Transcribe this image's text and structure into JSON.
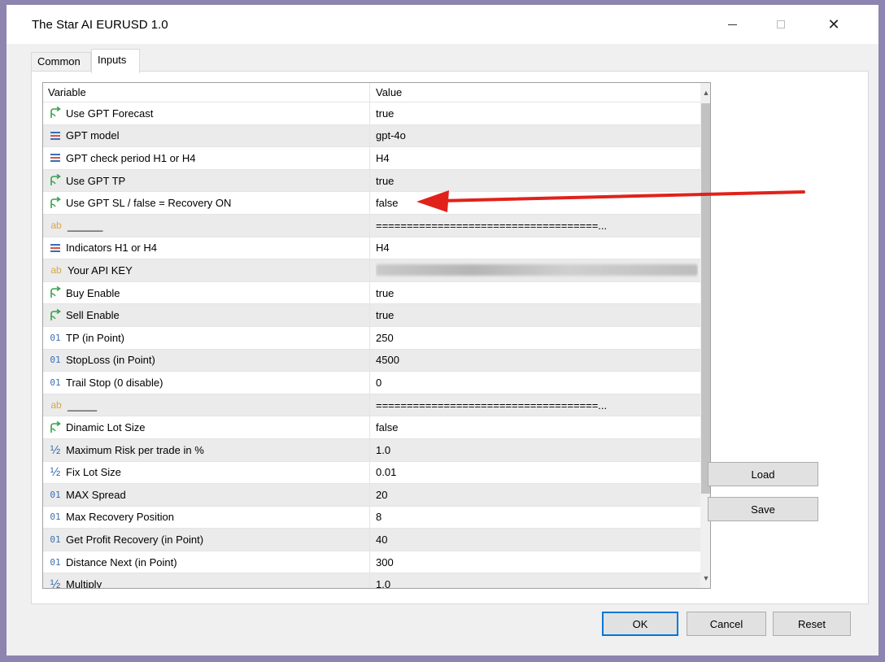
{
  "window": {
    "title": "The Star AI EURUSD 1.0"
  },
  "tabs": [
    {
      "label": "Common"
    },
    {
      "label": "Inputs"
    }
  ],
  "grid": {
    "columns": [
      "Variable",
      "Value"
    ],
    "rows": [
      {
        "icon": "toggle-arrow-icon",
        "variable": "Use GPT Forecast",
        "value": "true"
      },
      {
        "icon": "enum-list-icon",
        "variable": "GPT model",
        "value": "gpt-4o"
      },
      {
        "icon": "enum-list-icon",
        "variable": "GPT check period H1 or H4",
        "value": "H4"
      },
      {
        "icon": "toggle-arrow-icon",
        "variable": "Use GPT TP",
        "value": "true"
      },
      {
        "icon": "toggle-arrow-icon",
        "variable": "Use GPT SL / false = Recovery ON",
        "value": "false"
      },
      {
        "icon": "string-ab-icon",
        "variable": "______",
        "value": "====================================..."
      },
      {
        "icon": "enum-list-icon",
        "variable": "Indicators H1 or H4",
        "value": "H4"
      },
      {
        "icon": "string-ab-icon",
        "variable": "Your API KEY",
        "value": ""
      },
      {
        "icon": "toggle-arrow-icon",
        "variable": "Buy Enable",
        "value": "true"
      },
      {
        "icon": "toggle-arrow-icon",
        "variable": "Sell Enable",
        "value": "true"
      },
      {
        "icon": "integer-01-icon",
        "variable": "TP (in Point)",
        "value": "250"
      },
      {
        "icon": "integer-01-icon",
        "variable": "StopLoss (in Point)",
        "value": "4500"
      },
      {
        "icon": "integer-01-icon",
        "variable": "Trail Stop (0 disable)",
        "value": "0"
      },
      {
        "icon": "string-ab-icon",
        "variable": "_____",
        "value": "====================================..."
      },
      {
        "icon": "toggle-arrow-icon",
        "variable": "Dinamic Lot Size",
        "value": "false"
      },
      {
        "icon": "fraction-half-icon",
        "variable": "Maximum Risk per trade in %",
        "value": "1.0"
      },
      {
        "icon": "fraction-half-icon",
        "variable": "Fix Lot Size",
        "value": "0.01"
      },
      {
        "icon": "integer-01-icon",
        "variable": "MAX Spread",
        "value": "20"
      },
      {
        "icon": "integer-01-icon",
        "variable": "Max Recovery Position",
        "value": "8"
      },
      {
        "icon": "integer-01-icon",
        "variable": "Get Profit Recovery (in Point)",
        "value": "40"
      },
      {
        "icon": "integer-01-icon",
        "variable": "Distance Next (in Point)",
        "value": "300"
      },
      {
        "icon": "fraction-half-icon",
        "variable": "Multiply",
        "value": "1.0"
      }
    ]
  },
  "buttons": {
    "load": "Load",
    "save": "Save",
    "ok": "OK",
    "cancel": "Cancel",
    "reset": "Reset"
  },
  "colors": {
    "frame": "#8e84b0",
    "annotation_arrow": "#e0221b",
    "toggle_icon": "#3aa14a",
    "numeric_icon": "#3a6fb5",
    "string_icon": "#d9a64c"
  }
}
